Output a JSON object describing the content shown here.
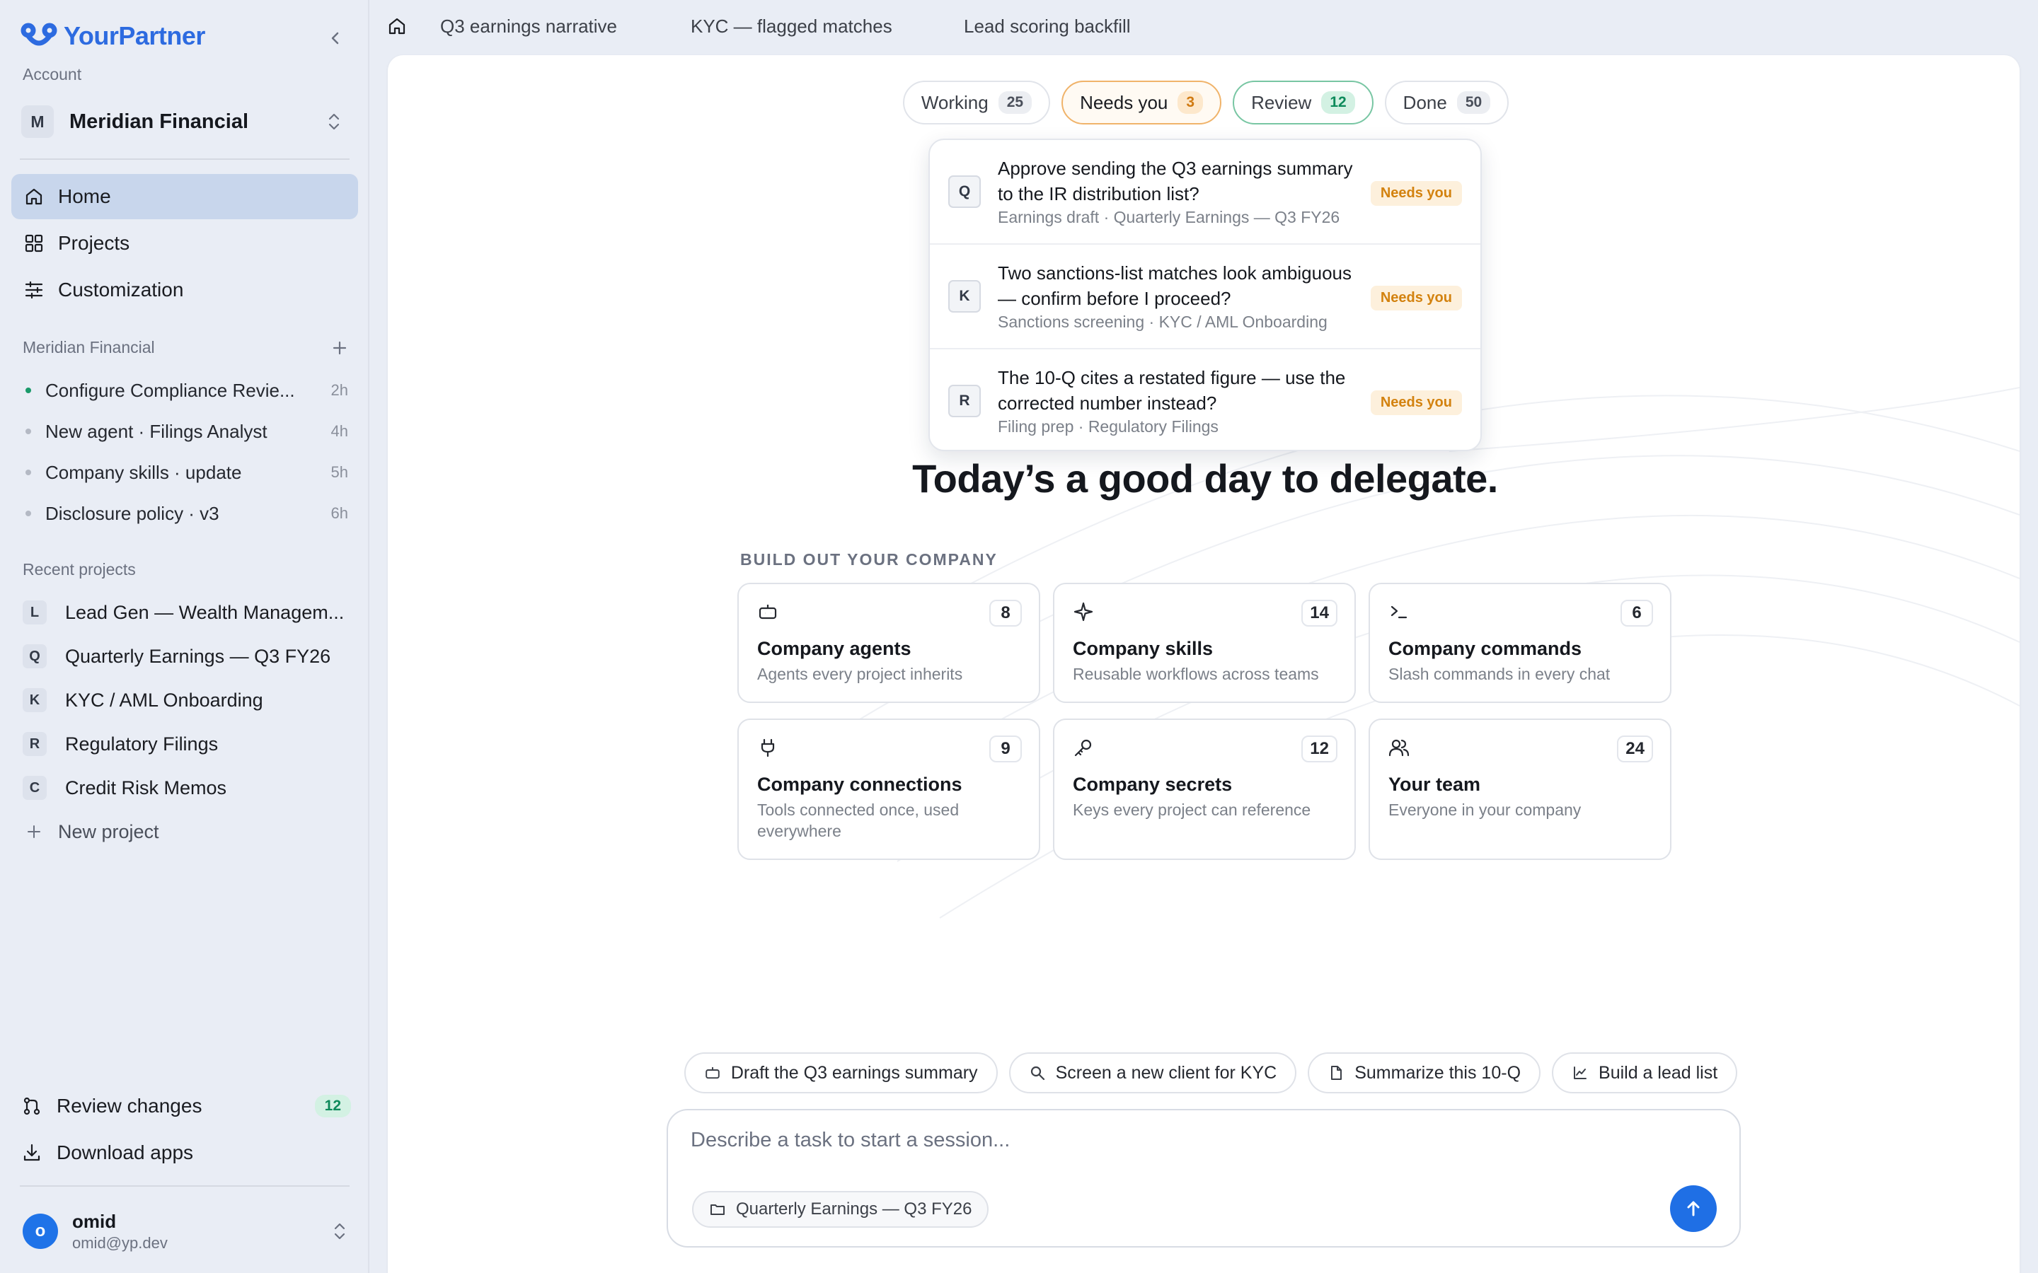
{
  "app": {
    "name": "YourPartner",
    "brand_color": "#2d6be0"
  },
  "sidebar": {
    "account_label": "Account",
    "account": {
      "initial": "M",
      "name": "Meridian Financial"
    },
    "nav": [
      {
        "label": "Home",
        "icon": "home-icon",
        "active": true
      },
      {
        "label": "Projects",
        "icon": "grid-icon",
        "active": false
      },
      {
        "label": "Customization",
        "icon": "sliders-icon",
        "active": false
      }
    ],
    "sessions_header": "Meridian Financial",
    "sessions": [
      {
        "title": "Configure Compliance Revie...",
        "time": "2h",
        "status": "active"
      },
      {
        "title": "New agent · Filings Analyst",
        "time": "4h",
        "status": "idle"
      },
      {
        "title": "Company skills · update",
        "time": "5h",
        "status": "idle"
      },
      {
        "title": "Disclosure policy · v3",
        "time": "6h",
        "status": "idle"
      }
    ],
    "recent_header": "Recent projects",
    "projects": [
      {
        "initial": "L",
        "name": "Lead Gen — Wealth Managem..."
      },
      {
        "initial": "Q",
        "name": "Quarterly Earnings — Q3 FY26"
      },
      {
        "initial": "K",
        "name": "KYC / AML Onboarding"
      },
      {
        "initial": "R",
        "name": "Regulatory Filings"
      },
      {
        "initial": "C",
        "name": "Credit Risk Memos"
      }
    ],
    "new_project": "New project",
    "review_changes": {
      "label": "Review changes",
      "count": "12"
    },
    "download_apps": "Download apps",
    "user": {
      "initial": "o",
      "name": "omid",
      "email": "omid@yp.dev"
    }
  },
  "topbar": {
    "tabs": [
      "Q3 earnings narrative",
      "KYC — flagged matches",
      "Lead scoring backfill"
    ]
  },
  "status_pills": [
    {
      "label": "Working",
      "count": "25"
    },
    {
      "label": "Needs you",
      "count": "3"
    },
    {
      "label": "Review",
      "count": "12"
    },
    {
      "label": "Done",
      "count": "50"
    }
  ],
  "needs_you_popup": [
    {
      "initial": "Q",
      "title": "Approve sending the Q3 earnings summary to the IR distribution list?",
      "meta": "Earnings draft · Quarterly Earnings — Q3 FY26",
      "badge": "Needs you"
    },
    {
      "initial": "K",
      "title": "Two sanctions-list matches look ambiguous — confirm before I proceed?",
      "meta": "Sanctions screening · KYC / AML Onboarding",
      "badge": "Needs you"
    },
    {
      "initial": "R",
      "title": "The 10-Q cites a restated figure — use the corrected number instead?",
      "meta": "Filing prep · Regulatory Filings",
      "badge": "Needs you"
    }
  ],
  "headline": "Today’s a good day to delegate.",
  "build_label": "BUILD OUT YOUR COMPANY",
  "cards": [
    {
      "icon": "robot-icon",
      "count": "8",
      "title": "Company agents",
      "subtitle": "Agents every project inherits"
    },
    {
      "icon": "sparkle-icon",
      "count": "14",
      "title": "Company skills",
      "subtitle": "Reusable workflows across teams"
    },
    {
      "icon": "terminal-icon",
      "count": "6",
      "title": "Company commands",
      "subtitle": "Slash commands in every chat"
    },
    {
      "icon": "plug-icon",
      "count": "9",
      "title": "Company connections",
      "subtitle": "Tools connected once, used everywhere"
    },
    {
      "icon": "key-icon",
      "count": "12",
      "title": "Company secrets",
      "subtitle": "Keys every project can reference"
    },
    {
      "icon": "users-icon",
      "count": "24",
      "title": "Your team",
      "subtitle": "Everyone in your company"
    }
  ],
  "suggestions": [
    {
      "icon": "robot-icon",
      "label": "Draft the Q3 earnings summary"
    },
    {
      "icon": "search-icon",
      "label": "Screen a new client for KYC"
    },
    {
      "icon": "file-icon",
      "label": "Summarize this 10-Q"
    },
    {
      "icon": "chart-icon",
      "label": "Build a lead list"
    }
  ],
  "composer": {
    "placeholder": "Describe a task to start a session...",
    "value": "",
    "project_chip": "Quarterly Earnings — Q3 FY26"
  }
}
